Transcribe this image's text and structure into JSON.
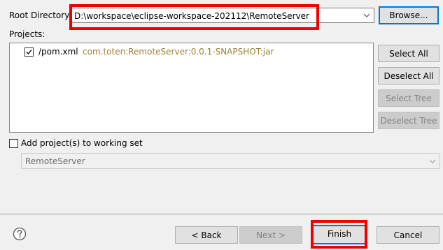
{
  "root_directory": {
    "label": "Root Directory:",
    "value": "D:\\workspace\\eclipse-workspace-202112\\RemoteServer",
    "browse_label": "Browse..."
  },
  "projects": {
    "label": "Projects:",
    "items": [
      {
        "name": "/pom.xml",
        "artifact": "com.toten:RemoteServer:0.0.1-SNAPSHOT:jar",
        "checked": true
      }
    ],
    "buttons": {
      "select_all": "Select All",
      "deselect_all": "Deselect All",
      "select_tree": "Select Tree",
      "deselect_tree": "Deselect Tree"
    }
  },
  "working_set": {
    "checkbox_label": "Add project(s) to working set",
    "checked": false,
    "combo_value": "RemoteServer"
  },
  "footer": {
    "back_label": "< Back",
    "next_label": "Next >",
    "finish_label": "Finish",
    "cancel_label": "Cancel"
  },
  "colors": {
    "highlight_box": "#ee0000",
    "artifact_text": "#a08037",
    "default_button_border": "#0078d7"
  },
  "icons": {
    "help": "help-icon",
    "dropdown": "chevron-down-icon",
    "checkmark": "check-icon"
  }
}
